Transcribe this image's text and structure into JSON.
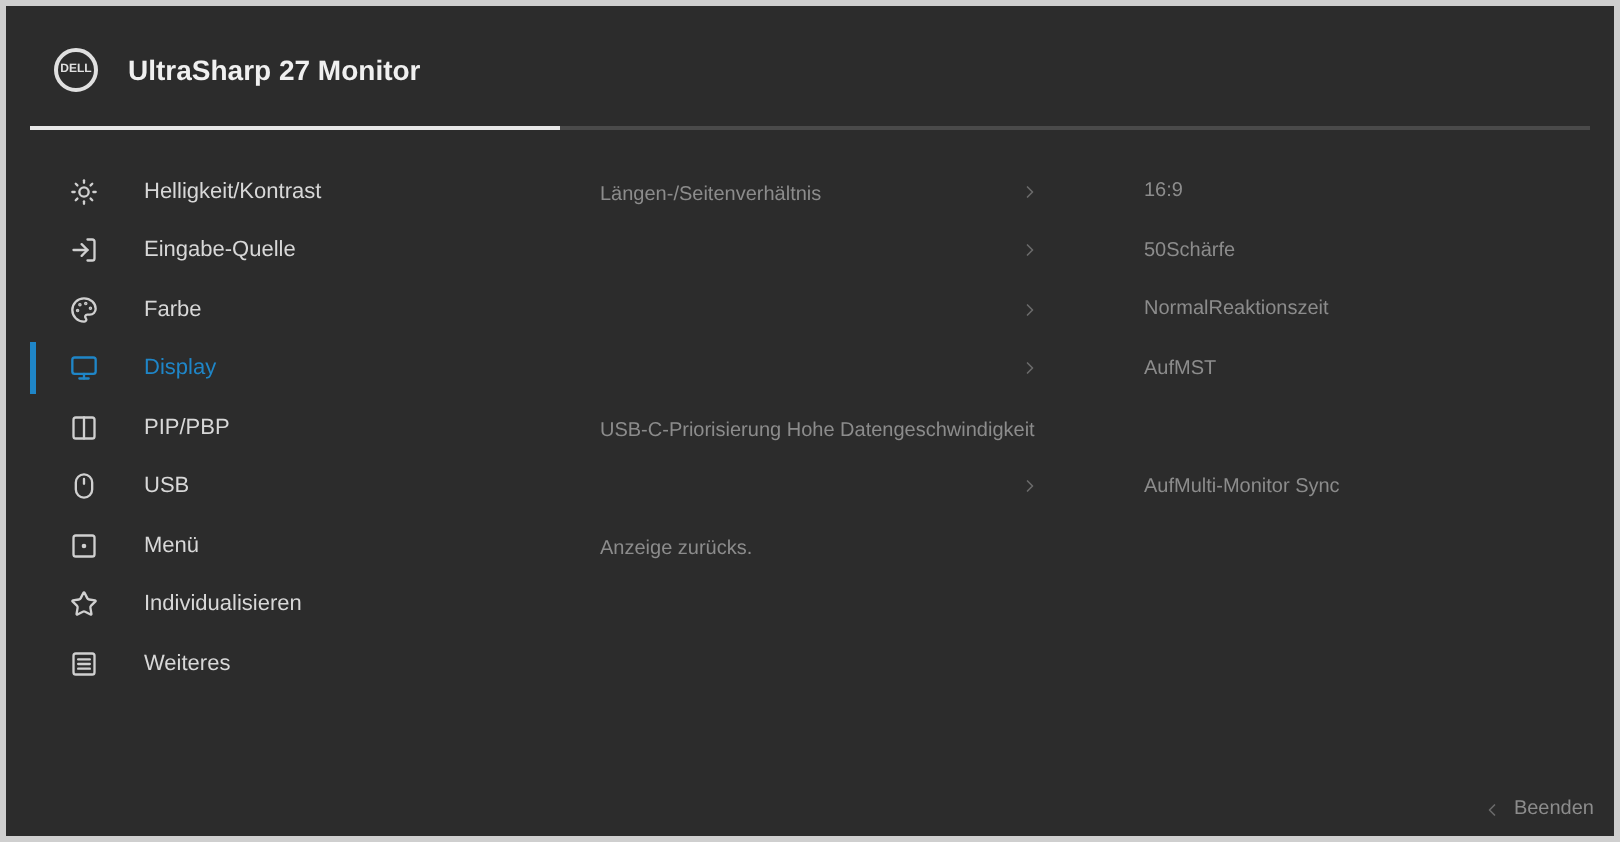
{
  "header": {
    "logo": "DELL",
    "title": "UltraSharp 27 Monitor",
    "level": 0.34
  },
  "menu": [
    {
      "label": "Helligkeit/Kontrast",
      "selected": false
    },
    {
      "label": "Eingabe-Quelle",
      "selected": false
    },
    {
      "label": "Farbe",
      "selected": false
    },
    {
      "label": "Display",
      "selected": true
    },
    {
      "label": "PIP/PBP",
      "selected": false
    },
    {
      "label": "USB",
      "selected": false
    },
    {
      "label": "Menü",
      "selected": false
    },
    {
      "label": "Individualisieren",
      "selected": false
    },
    {
      "label": "Weiteres",
      "selected": false
    }
  ],
  "settings": [
    {
      "label": "Längen-/Seitenverhältnis",
      "submenu": true,
      "value": "16:9"
    },
    {
      "submenu": true,
      "value": "50Schärfe"
    },
    {
      "submenu": true,
      "value": "NormalReaktionszeit"
    },
    {
      "submenu": true,
      "value": "AufMST"
    },
    {
      "label": "USB-C-Priorisierung Hohe Datengeschwindigkeit",
      "submenu": false
    },
    {
      "submenu": true,
      "value": "AufMulti-Monitor Sync"
    },
    {
      "label": "Anzeige zurücks.",
      "submenu": false
    }
  ],
  "footer": {
    "exit": "Beenden"
  }
}
